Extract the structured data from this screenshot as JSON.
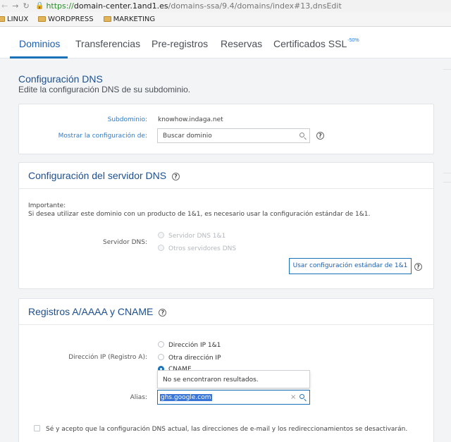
{
  "browser": {
    "url_protocol": "https://",
    "url_host": "domain-center.1and1.es",
    "url_path": "/domains-ssa/9.4/domains/index#13,dnsEdit",
    "bookmarks": [
      "LINUX",
      "WORDPRESS",
      "MARKETING"
    ]
  },
  "tabs": [
    {
      "label": "Dominios"
    },
    {
      "label": "Transferencias"
    },
    {
      "label": "Pre-registros"
    },
    {
      "label": "Reservas"
    },
    {
      "label": "Certificados SSL"
    }
  ],
  "ssl_badge": "-50%",
  "page": {
    "title": "Configuración DNS",
    "subtitle": "Edite la configuración DNS de su subdominio."
  },
  "subdomain_card": {
    "subdomain_label": "Subdominio:",
    "subdomain_value": "knowhow.indaga.net",
    "show_config_label": "Mostrar la configuración de:",
    "search_value": "Buscar dominio"
  },
  "dns_server_card": {
    "title": "Configuración del servidor DNS",
    "important_title": "Importante:",
    "important_text": "Si desea utilizar este dominio con un producto de 1&1, es necesario usar la configuración estándar de 1&1.",
    "server_label": "Servidor DNS:",
    "options": [
      "Servidor DNS 1&1",
      "Otros servidores DNS"
    ],
    "button_label": "Usar configuración estándar de 1&1"
  },
  "records_card": {
    "title": "Registros A/AAAA y CNAME",
    "ip_label": "Dirección IP (Registro A):",
    "options": [
      "Dirección IP 1&1",
      "Otra dirección IP",
      "CNAME"
    ],
    "dropdown_message": "No se encontraron resultados.",
    "alias_label": "Alias:",
    "alias_value": "ghs.google.com",
    "confirm_text": "Sé y acepto que la configuración DNS actual, las direcciones de e-mail y los redireccionamientos se desactivarán."
  },
  "colors": {
    "accent": "#1a73b9",
    "title_blue": "#1d4f8f",
    "page_bg": "#f3f4f6"
  }
}
